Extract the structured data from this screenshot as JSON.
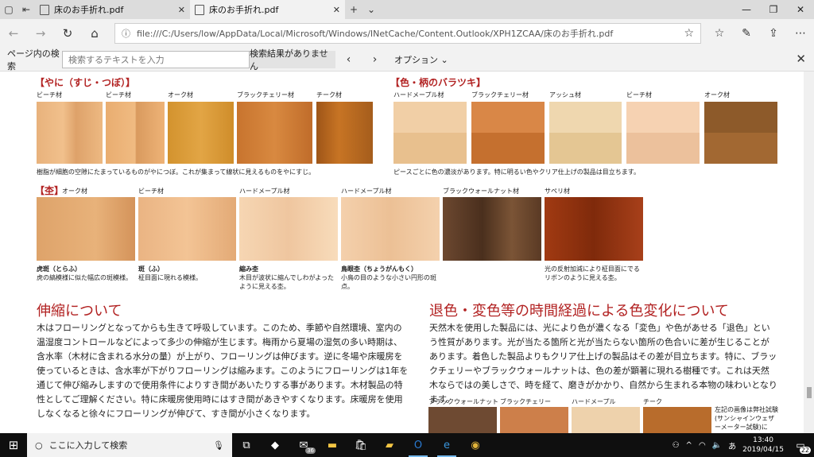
{
  "tabs": [
    {
      "label": "床のお手折れ.pdf"
    },
    {
      "label": "床のお手折れ.pdf"
    }
  ],
  "address": {
    "url": "file:///C:/Users/low/AppData/Local/Microsoft/Windows/INetCache/Content.Outlook/XPH1ZCAA/床のお手折れ.pdf"
  },
  "find": {
    "label": "ページ内の検索",
    "placeholder": "検索するテキストを入力",
    "status": "検索結果がありません",
    "options": "オプション"
  },
  "doc": {
    "sec1": "【やに（すじ・つぼ）】",
    "sec1_labels": [
      "ビーチ材",
      "ビーチ材",
      "オーク材",
      "ブラックチェリー材",
      "チーク材"
    ],
    "sec1_caption": "樹脂が細胞の空隙にたまっているものがやにつぼ。これが集まって線状に見えるものをやにすじ。",
    "sec2": "【色・柄のバラツキ】",
    "sec2_labels": [
      "ハードメープル材",
      "ブラックチェリー材",
      "アッシュ材",
      "ビーチ材",
      "オーク材"
    ],
    "sec2_caption": "ピースごとに色の濃淡があります。特に明るい色やクリア仕上げの製品は目立ちます。",
    "sec3": "【杢】",
    "sec3_labels": [
      "オーク材",
      "ビーチ材",
      "ハードメープル材",
      "ハードメープル材",
      "ブラックウォールナット材",
      "サペリ材"
    ],
    "notes": [
      {
        "title": "虎斑（とらふ）",
        "text": "虎の縞模様に似た幅広の斑模様。"
      },
      {
        "title": "斑（ふ）",
        "text": "柾目面に現れる模様。"
      },
      {
        "title": "縮み杢",
        "text": "木目が波状に縮んでしわがよったように見える杢。"
      },
      {
        "title": "鳥眼杢（ちょうがんもく）",
        "text": "小鳥の目のような小さい円形の斑点。"
      },
      {
        "title": "",
        "text": "光の反射加減により柾目面にでるリボンのように見える杢。"
      }
    ],
    "head1": "伸縮について",
    "body1": "木はフローリングとなってからも生きて呼吸しています。このため、季節や自然環境、室内の温湿度コントロールなどによって多少の伸縮が生じます。梅雨から夏場の湿気の多い時期は、含水率（木材に含まれる水分の量）が上がり、フローリングは伸びます。逆に冬場や床暖房を使っているときは、含水率が下がりフローリングは縮みます。このようにフローリングは1年を通じて伸び縮みしますので使用条件によりすき間があいたりする事があります。木材製品の特性としてご理解ください。特に床暖房使用時にはすき間があきやすくなります。床暖房を使用しなくなると徐々にフローリングが伸びて、すき間が小さくなります。",
    "head2": "退色・変色等の時間経過による色変化について",
    "body2": "天然木を使用した製品には、光により色が濃くなる「変色」や色があせる「退色」という性質があります。光が当たる箇所と光が当たらない箇所の色合いに差が生じることがあります。着色した製品よりもクリア仕上げの製品はその差が目立ちます。特に、ブラックチェリーやブラックウォールナットは、色の差が顕著に現れる樹種です。これは天然木ならではの美しさで、時を経て、磨きがかかり、自然から生まれる本物の味わいとなります。",
    "bottom_labels": [
      "ブラックウォールナット",
      "ブラックチェリー",
      "ハードメープル",
      "チーク"
    ],
    "bottom_note": "左記の画像は弊社試験(サンシャインウェザーメーター試験)に"
  },
  "taskbar": {
    "search": "ここに入力して検索",
    "time": "13:40",
    "date": "2019/04/15",
    "mail_badge": "36",
    "notif_count": "22"
  }
}
